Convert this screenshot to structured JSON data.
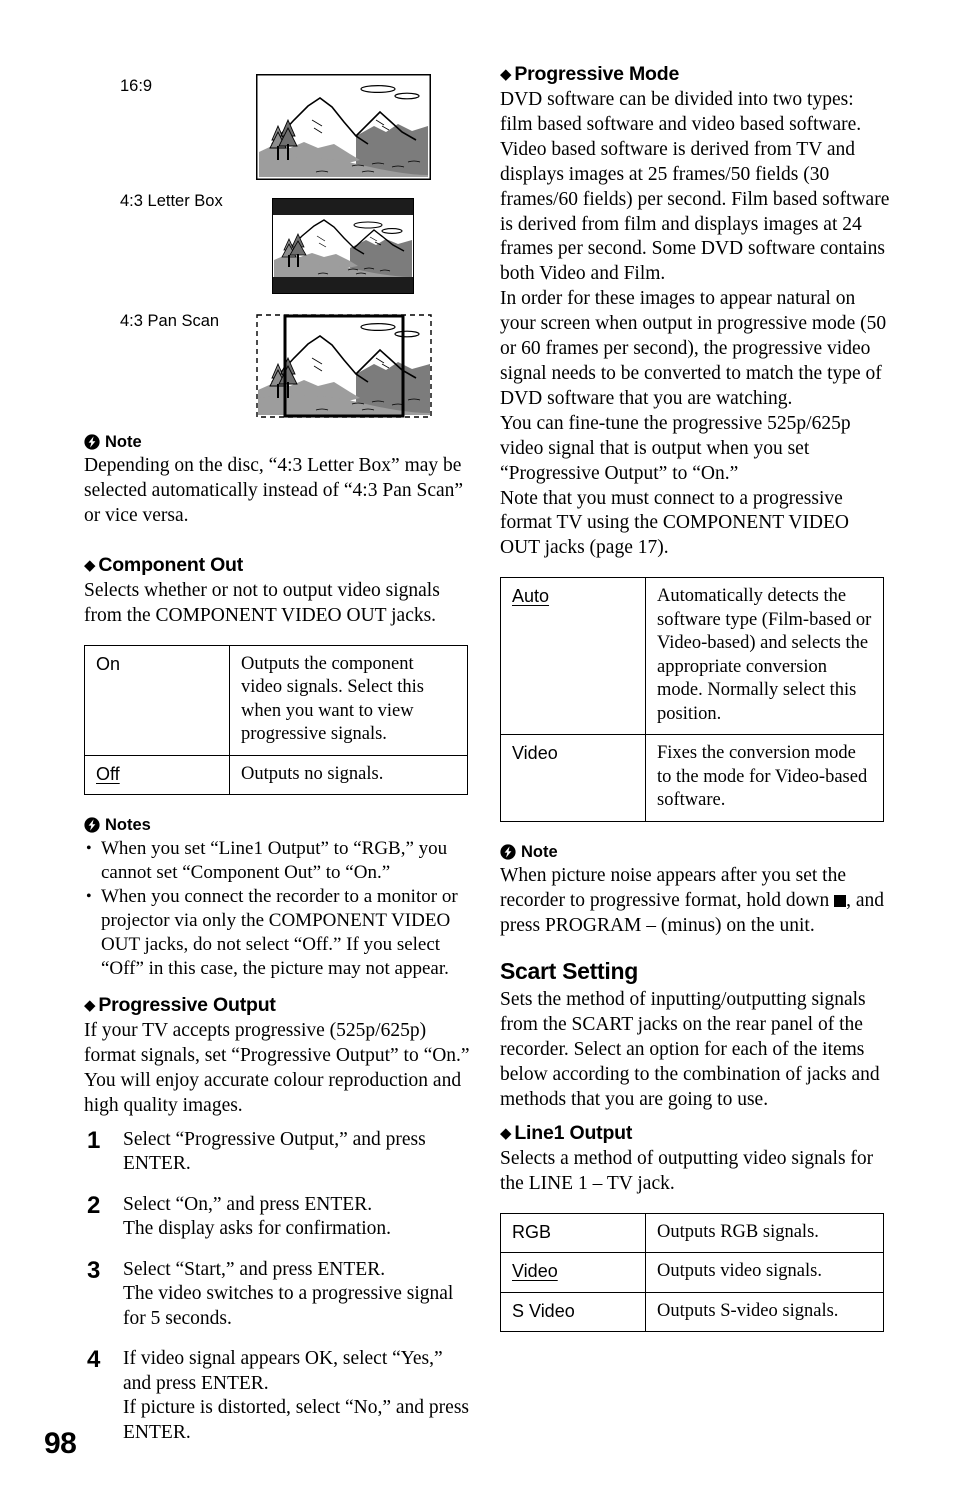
{
  "page": {
    "number": "98"
  },
  "diagrams": {
    "aspect_labels": [
      {
        "id": "ratio-16-9",
        "text": "16:9"
      },
      {
        "id": "ratio-4-3-letter",
        "text": "4:3 Letter Box"
      },
      {
        "id": "ratio-4-3-pan",
        "text": "4:3 Pan Scan"
      }
    ]
  },
  "left_column": {
    "note_1": {
      "heading": "Note",
      "body": "Depending on the disc, “4:3 Letter Box” may be selected automatically instead of “4:3 Pan Scan” or vice versa."
    },
    "component_out": {
      "heading": "Component Out",
      "intro": "Selects whether or not to output video signals from the COMPONENT VIDEO OUT jacks.",
      "table": [
        {
          "key": "On",
          "underlined": false,
          "value": "Outputs the component video signals. Select this when you want to view progressive signals."
        },
        {
          "key": "Off",
          "underlined": true,
          "value": "Outputs no signals."
        }
      ]
    },
    "notes_2": {
      "heading": "Notes",
      "items": [
        "When you set “Line1 Output” to “RGB,” you cannot set “Component Out” to “On.”",
        "When you connect the recorder to a monitor or projector via only the COMPONENT VIDEO OUT jacks, do not select “Off.” If you select “Off” in this case, the picture may not appear."
      ]
    },
    "progressive_output": {
      "heading": "Progressive Output",
      "intro": "If your TV accepts progressive (525p/625p) format signals, set “Progressive Output” to “On.” You will enjoy accurate colour reproduction and high quality images.",
      "steps": [
        {
          "num": "1",
          "lines": [
            "Select “Progressive Output,” and press ENTER."
          ]
        },
        {
          "num": "2",
          "lines": [
            "Select “On,” and press ENTER.",
            "The display asks for confirmation."
          ]
        },
        {
          "num": "3",
          "lines": [
            "Select “Start,” and press ENTER.",
            "The video switches to a progressive signal for 5 seconds."
          ]
        },
        {
          "num": "4",
          "lines": [
            "If video signal appears OK, select “Yes,” and press ENTER.",
            "If picture is distorted, select “No,” and press ENTER."
          ]
        }
      ]
    }
  },
  "right_column": {
    "progressive_mode": {
      "heading": "Progressive Mode",
      "paragraphs": [
        "DVD software can be divided into two types: film based software and video based software. Video based software is derived from TV and displays images at 25 frames/50 fields (30 frames/60 fields) per second. Film based software is derived from film and displays images at 24 frames per second. Some DVD software contains both Video and Film.",
        "In order for these images to appear natural on your screen when output in progressive mode (50 or 60 frames per second), the progressive video signal needs to be converted to match the type of DVD software that you are watching.",
        "You can fine-tune the progressive 525p/625p video signal that is output when you set “Progressive Output” to “On.”",
        "Note that you must connect to a progressive format TV using the COMPONENT VIDEO OUT jacks (page 17)."
      ],
      "table": [
        {
          "key": "Auto",
          "underlined": true,
          "value": "Automatically detects the software type (Film-based or Video-based) and selects the appropriate conversion mode. Normally select this position."
        },
        {
          "key": "Video",
          "underlined": false,
          "value": "Fixes the conversion mode to the mode for Video-based software."
        }
      ]
    },
    "note_3": {
      "heading": "Note",
      "body_before_icon": "When picture noise appears after you set the recorder to progressive format, hold down ",
      "body_after_icon": ", and press PROGRAM – (minus) on the unit."
    },
    "scart_setting": {
      "heading": "Scart Setting",
      "intro": "Sets the method of inputting/outputting signals from the SCART jacks on the rear panel of the recorder. Select an option for each of the items below according to the combination of jacks and methods that you are going to use."
    },
    "line1_output": {
      "heading": "Line1 Output",
      "intro": "Selects a method of outputting video signals for the LINE 1 – TV jack.",
      "table": [
        {
          "key": "RGB",
          "underlined": false,
          "value": "Outputs RGB signals."
        },
        {
          "key": "Video",
          "underlined": true,
          "value": "Outputs video signals."
        },
        {
          "key": "S Video",
          "underlined": false,
          "value": "Outputs S-video signals."
        }
      ]
    }
  },
  "icons": {
    "note_icon": "lightning-bolt-circle-icon",
    "diamond_bullet": "diamond-bullet-icon",
    "stop_button": "stop-square-icon"
  },
  "colors": {
    "text": "#000000",
    "background": "#ffffff",
    "illustration_mid_grey": "#9a9a9a",
    "illustration_dark_grey": "#707070",
    "illustration_light_grey": "#c9c9c9"
  }
}
